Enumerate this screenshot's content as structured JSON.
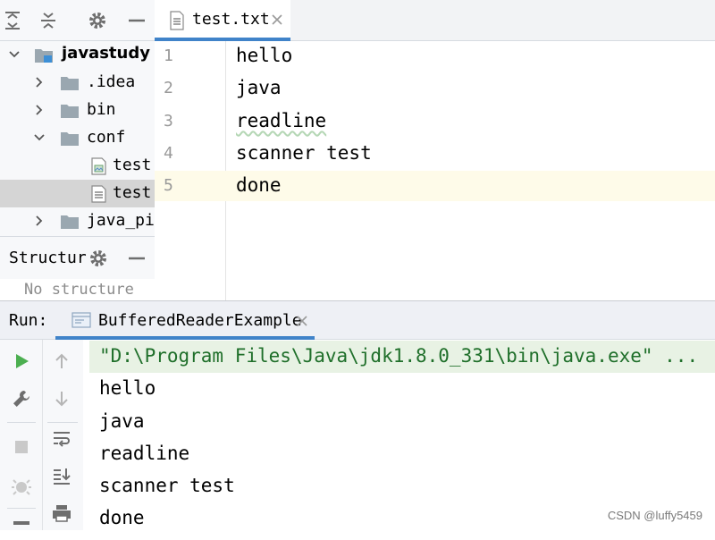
{
  "project": {
    "tree": [
      {
        "label": "javastudy",
        "type": "project-root"
      },
      {
        "label": ".idea",
        "type": "folder"
      },
      {
        "label": "bin",
        "type": "folder"
      },
      {
        "label": "conf",
        "type": "folder"
      },
      {
        "label": "test.",
        "type": "image-file"
      },
      {
        "label": "test.",
        "type": "text-file"
      },
      {
        "label": "java_pic",
        "type": "folder"
      }
    ]
  },
  "structure": {
    "title": "Structur",
    "empty_text": "No structure"
  },
  "editor": {
    "tab_label": "test.txt",
    "line_numbers": [
      "1",
      "2",
      "3",
      "4",
      "5"
    ],
    "lines": [
      "hello",
      "java",
      "readline",
      "scanner test",
      "done"
    ]
  },
  "run": {
    "label": "Run:",
    "tab_label": "BufferedReaderExample",
    "console": [
      "\"D:\\Program Files\\Java\\jdk1.8.0_331\\bin\\java.exe\" ...",
      "hello",
      "java",
      "readline",
      "scanner test",
      "done"
    ]
  },
  "watermark": "CSDN @luffy5459",
  "colors": {
    "accent": "#4083c9",
    "run_green": "#4caf50",
    "folder": "#9aa7b0",
    "command_line_bg": "#e8f2e4"
  }
}
